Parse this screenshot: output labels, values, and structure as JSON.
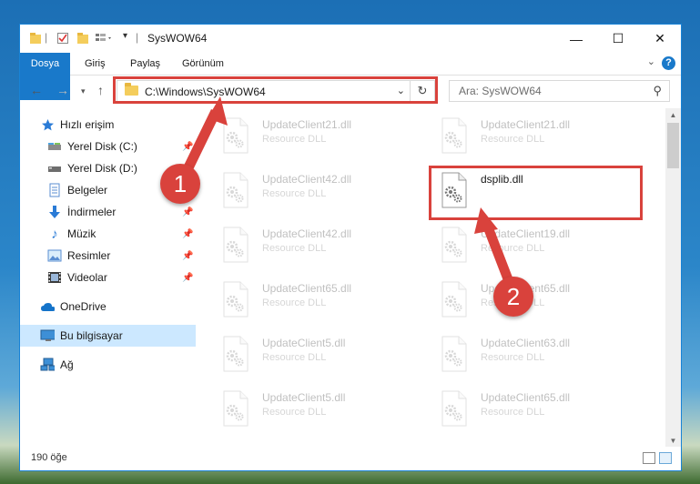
{
  "window": {
    "title": "SysWOW64",
    "controls": {
      "minimize": "—",
      "maximize": "☐",
      "close": "✕"
    }
  },
  "ribbon": {
    "tabs": [
      "Dosya",
      "Giriş",
      "Paylaş",
      "Görünüm"
    ],
    "help": "?"
  },
  "address": {
    "path": "C:\\Windows\\SysWOW64",
    "search_placeholder": "Ara: SysWOW64"
  },
  "navpane": {
    "quick_access": "Hızlı erişim",
    "items": [
      {
        "label": "Yerel Disk (C:)",
        "icon": "drive-icon",
        "pinned": true
      },
      {
        "label": "Yerel Disk (D:)",
        "icon": "drive-icon",
        "pinned": false
      },
      {
        "label": "Belgeler",
        "icon": "documents-icon",
        "pinned": true
      },
      {
        "label": "İndirmeler",
        "icon": "download-icon",
        "pinned": true
      },
      {
        "label": "Müzik",
        "icon": "music-icon",
        "pinned": true
      },
      {
        "label": "Resimler",
        "icon": "pictures-icon",
        "pinned": true
      },
      {
        "label": "Videolar",
        "icon": "videos-icon",
        "pinned": true
      }
    ],
    "onedrive": "OneDrive",
    "this_pc": "Bu bilgisayar",
    "network": "Ağ"
  },
  "files": {
    "highlighted": {
      "name": "dsplib.dll",
      "type": "Resource DLL"
    },
    "left_column": [
      {
        "name": "UpdateClient21.dll",
        "type": "Resource DLL"
      },
      {
        "name": "UpdateClient42.dll",
        "type": "Resource DLL"
      },
      {
        "name": "UpdateClient42.dll",
        "type": "Resource DLL"
      },
      {
        "name": "UpdateClient65.dll",
        "type": "Resource DLL"
      },
      {
        "name": "UpdateClient5.dll",
        "type": "Resource DLL"
      },
      {
        "name": "UpdateClient5.dll",
        "type": "Resource DLL"
      }
    ],
    "right_column": [
      {
        "name": "UpdateClient21.dll",
        "type": "Resource DLL"
      },
      {
        "name": "UpdateClient19.dll",
        "type": "Resource DLL"
      },
      {
        "name": "UpdateClient65.dll",
        "type": "Resource DLL"
      },
      {
        "name": "UpdateClient63.dll",
        "type": "Resource DLL"
      },
      {
        "name": "UpdateClient65.dll",
        "type": "Resource DLL"
      }
    ]
  },
  "status": {
    "count": "190 öğe"
  },
  "annotations": {
    "step1": "1",
    "step2": "2",
    "color": "#d9423c"
  }
}
